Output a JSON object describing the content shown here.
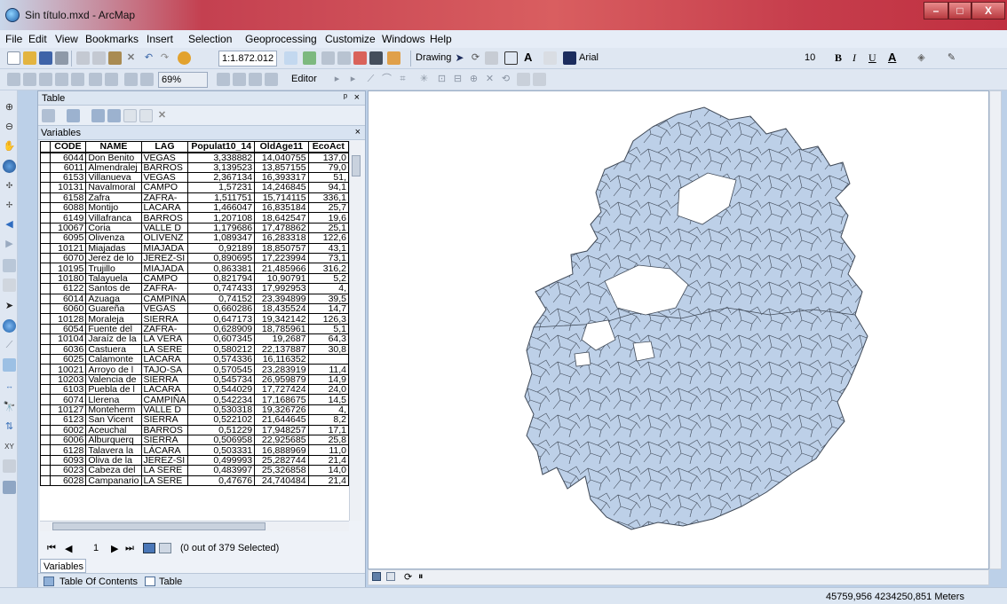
{
  "window": {
    "title": "Sin título.mxd - ArcMap"
  },
  "menu": [
    "File",
    "Edit",
    "View",
    "Bookmarks",
    "Insert",
    "Selection",
    "Geoprocessing",
    "Customize",
    "Windows",
    "Help"
  ],
  "toolbar": {
    "scale": "1:1.872.012",
    "drawing_label": "Drawing",
    "font_name": "Arial",
    "font_size": "10",
    "bold": "B",
    "italic": "I",
    "underline": "U",
    "font_color_letter": "A",
    "zoom_percent": "69%",
    "editor_label": "Editor"
  },
  "table_panel": {
    "title": "Table",
    "tab_title": "Variables",
    "columns": [
      "CODE",
      "NAME",
      "LAG",
      "Populat10_14",
      "OldAge11",
      "EcoAct"
    ],
    "rows": [
      [
        "6044",
        "Don Benito",
        "VEGAS",
        "3,338882",
        "14,040755",
        "137,0"
      ],
      [
        "6011",
        "Almendralej",
        "BARROS",
        "3,139523",
        "13,857155",
        "79,0"
      ],
      [
        "6153",
        "Villanueva",
        "VEGAS",
        "2,367134",
        "16,393317",
        "51,"
      ],
      [
        "10131",
        "Navalmoral",
        "CAMPO",
        "1,57231",
        "14,246845",
        "94,1"
      ],
      [
        "6158",
        "Zafra",
        "ZAFRA-",
        "1,511751",
        "15,714115",
        "336,1"
      ],
      [
        "6088",
        "Montijo",
        "LÁCARA",
        "1,466047",
        "16,835184",
        "25,7"
      ],
      [
        "6149",
        "Villafranca",
        "BARROS",
        "1,207108",
        "18,642547",
        "19,6"
      ],
      [
        "10067",
        "Coria",
        "VALLE D",
        "1,179686",
        "17,478862",
        "25,1"
      ],
      [
        "6095",
        "Olivenza",
        "OLIVENZ",
        "1,089347",
        "16,283318",
        "122,6"
      ],
      [
        "10121",
        "Miajadas",
        "MIAJADA",
        "0,92189",
        "18,850757",
        "43,1"
      ],
      [
        "6070",
        "Jerez de lo",
        "JEREZ-SI",
        "0,890695",
        "17,223994",
        "73,1"
      ],
      [
        "10195",
        "Trujillo",
        "MIAJADA",
        "0,863381",
        "21,485966",
        "316,2"
      ],
      [
        "10180",
        "Talayuela",
        "CAMPO",
        "0,821794",
        "10,90791",
        "5,2"
      ],
      [
        "6122",
        "Santos de",
        "ZAFRA-",
        "0,747433",
        "17,992953",
        "4,"
      ],
      [
        "6014",
        "Azuaga",
        "CAMPIÑA",
        "0,74152",
        "23,394899",
        "39,5"
      ],
      [
        "6060",
        "Guareña",
        "VEGAS",
        "0,660286",
        "18,435524",
        "14,7"
      ],
      [
        "10128",
        "Moraleja",
        "SIERRA",
        "0,647173",
        "19,342142",
        "126,3"
      ],
      [
        "6054",
        "Fuente del",
        "ZAFRA-",
        "0,628909",
        "18,785961",
        "5,1"
      ],
      [
        "10104",
        "Jaraíz de la",
        "LA VERA",
        "0,607345",
        "19,2687",
        "64,3"
      ],
      [
        "6036",
        "Castuera",
        "LA SERE",
        "0,580212",
        "22,137887",
        "30,8"
      ],
      [
        "6025",
        "Calamonte",
        "LÁCARA",
        "0,574336",
        "16,116352",
        ""
      ],
      [
        "10021",
        "Arroyo de l",
        "TAJO-SA",
        "0,570545",
        "23,283919",
        "11,4"
      ],
      [
        "10203",
        "Valencia de",
        "SIERRA",
        "0,545734",
        "26,959879",
        "14,9"
      ],
      [
        "6103",
        "Puebla de l",
        "LÁCARA",
        "0,544029",
        "17,727424",
        "24,0"
      ],
      [
        "6074",
        "Llerena",
        "CAMPIÑA",
        "0,542234",
        "17,168675",
        "14,5"
      ],
      [
        "10127",
        "Monteherm",
        "VALLE D",
        "0,530318",
        "19,326726",
        "4,"
      ],
      [
        "6123",
        "San Vicent",
        "SIERRA",
        "0,522102",
        "21,644645",
        "8,2"
      ],
      [
        "6002",
        "Aceuchal",
        "BARROS",
        "0,51229",
        "17,948257",
        "17,1"
      ],
      [
        "6006",
        "Alburquerq",
        "SIERRA",
        "0,506958",
        "22,925685",
        "25,8"
      ],
      [
        "6128",
        "Talavera la",
        "LÁCARA",
        "0,503331",
        "16,888969",
        "11,0"
      ],
      [
        "6093",
        "Oliva de la",
        "JEREZ-SI",
        "0,499993",
        "25,282744",
        "21,4"
      ],
      [
        "6023",
        "Cabeza del",
        "LA SERE",
        "0,483997",
        "25,326858",
        "14,0"
      ],
      [
        "6028",
        "Campanario",
        "LA SERE",
        "0,47676",
        "24,740484",
        "21,4"
      ]
    ],
    "record_number": "1",
    "selection_status": "(0 out of 379 Selected)",
    "variables_tab": "Variables",
    "toc_tab": "Table Of Contents",
    "table_tab": "Table"
  },
  "status": {
    "coordinates": "45759,956 4234250,851 Meters"
  },
  "map": {
    "fill_color": "#bdd0e8",
    "stroke_color": "#404a58"
  }
}
